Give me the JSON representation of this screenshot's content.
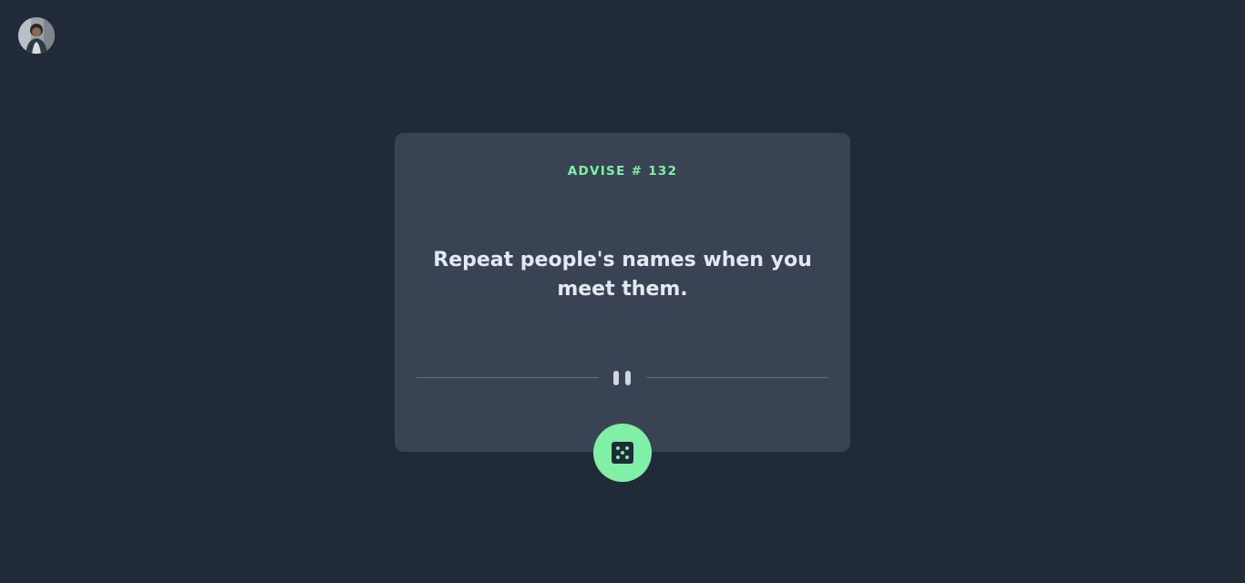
{
  "profile": {
    "avatar_icon": "user-avatar-icon"
  },
  "card": {
    "advice_id_label": "ADVISE # 132",
    "advice_text": "Repeat people's names when you meet them.",
    "divider_icon": "pause-icon",
    "dice_icon": "dice-icon"
  },
  "colors": {
    "background": "#202a38",
    "card": "#3a4354",
    "accent": "#7ff0a6",
    "text": "#e3e9f2"
  }
}
